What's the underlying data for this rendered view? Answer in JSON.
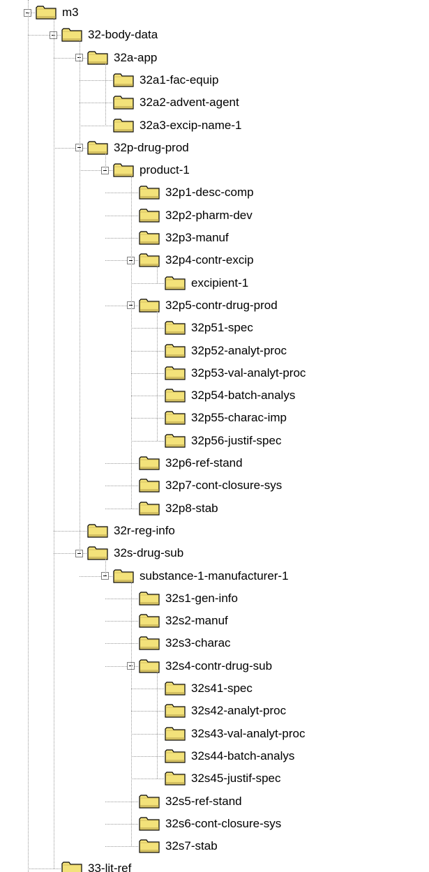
{
  "tree": {
    "root": {
      "label": "m3",
      "expanded": true,
      "children": [
        {
          "label": "32-body-data",
          "expanded": true,
          "children": [
            {
              "label": "32a-app",
              "expanded": true,
              "children": [
                {
                  "label": "32a1-fac-equip"
                },
                {
                  "label": "32a2-advent-agent"
                },
                {
                  "label": "32a3-excip-name-1"
                }
              ]
            },
            {
              "label": "32p-drug-prod",
              "expanded": true,
              "children": [
                {
                  "label": "product-1",
                  "expanded": true,
                  "children": [
                    {
                      "label": "32p1-desc-comp"
                    },
                    {
                      "label": "32p2-pharm-dev"
                    },
                    {
                      "label": "32p3-manuf"
                    },
                    {
                      "label": "32p4-contr-excip",
                      "expanded": true,
                      "children": [
                        {
                          "label": "excipient-1"
                        }
                      ]
                    },
                    {
                      "label": "32p5-contr-drug-prod",
                      "expanded": true,
                      "children": [
                        {
                          "label": "32p51-spec"
                        },
                        {
                          "label": "32p52-analyt-proc"
                        },
                        {
                          "label": "32p53-val-analyt-proc"
                        },
                        {
                          "label": "32p54-batch-analys"
                        },
                        {
                          "label": "32p55-charac-imp"
                        },
                        {
                          "label": "32p56-justif-spec"
                        }
                      ]
                    },
                    {
                      "label": "32p6-ref-stand"
                    },
                    {
                      "label": "32p7-cont-closure-sys"
                    },
                    {
                      "label": "32p8-stab"
                    }
                  ]
                }
              ]
            },
            {
              "label": "32r-reg-info"
            },
            {
              "label": "32s-drug-sub",
              "expanded": true,
              "children": [
                {
                  "label": "substance-1-manufacturer-1",
                  "expanded": true,
                  "children": [
                    {
                      "label": "32s1-gen-info"
                    },
                    {
                      "label": "32s2-manuf"
                    },
                    {
                      "label": "32s3-charac"
                    },
                    {
                      "label": "32s4-contr-drug-sub",
                      "expanded": true,
                      "children": [
                        {
                          "label": "32s41-spec"
                        },
                        {
                          "label": "32s42-analyt-proc"
                        },
                        {
                          "label": "32s43-val-analyt-proc"
                        },
                        {
                          "label": "32s44-batch-analys"
                        },
                        {
                          "label": "32s45-justif-spec"
                        }
                      ]
                    },
                    {
                      "label": "32s5-ref-stand"
                    },
                    {
                      "label": "32s6-cont-closure-sys"
                    },
                    {
                      "label": "32s7-stab"
                    }
                  ]
                }
              ]
            }
          ]
        },
        {
          "label": "33-lit-ref"
        }
      ]
    }
  },
  "icons": {
    "folder": "folder-icon",
    "expander": "collapse-minus-icon"
  },
  "colors": {
    "folder_fill": "#f3e27a",
    "folder_shade": "#d4c062",
    "folder_outline": "#000000",
    "tree_line": "#9a9a9a"
  }
}
